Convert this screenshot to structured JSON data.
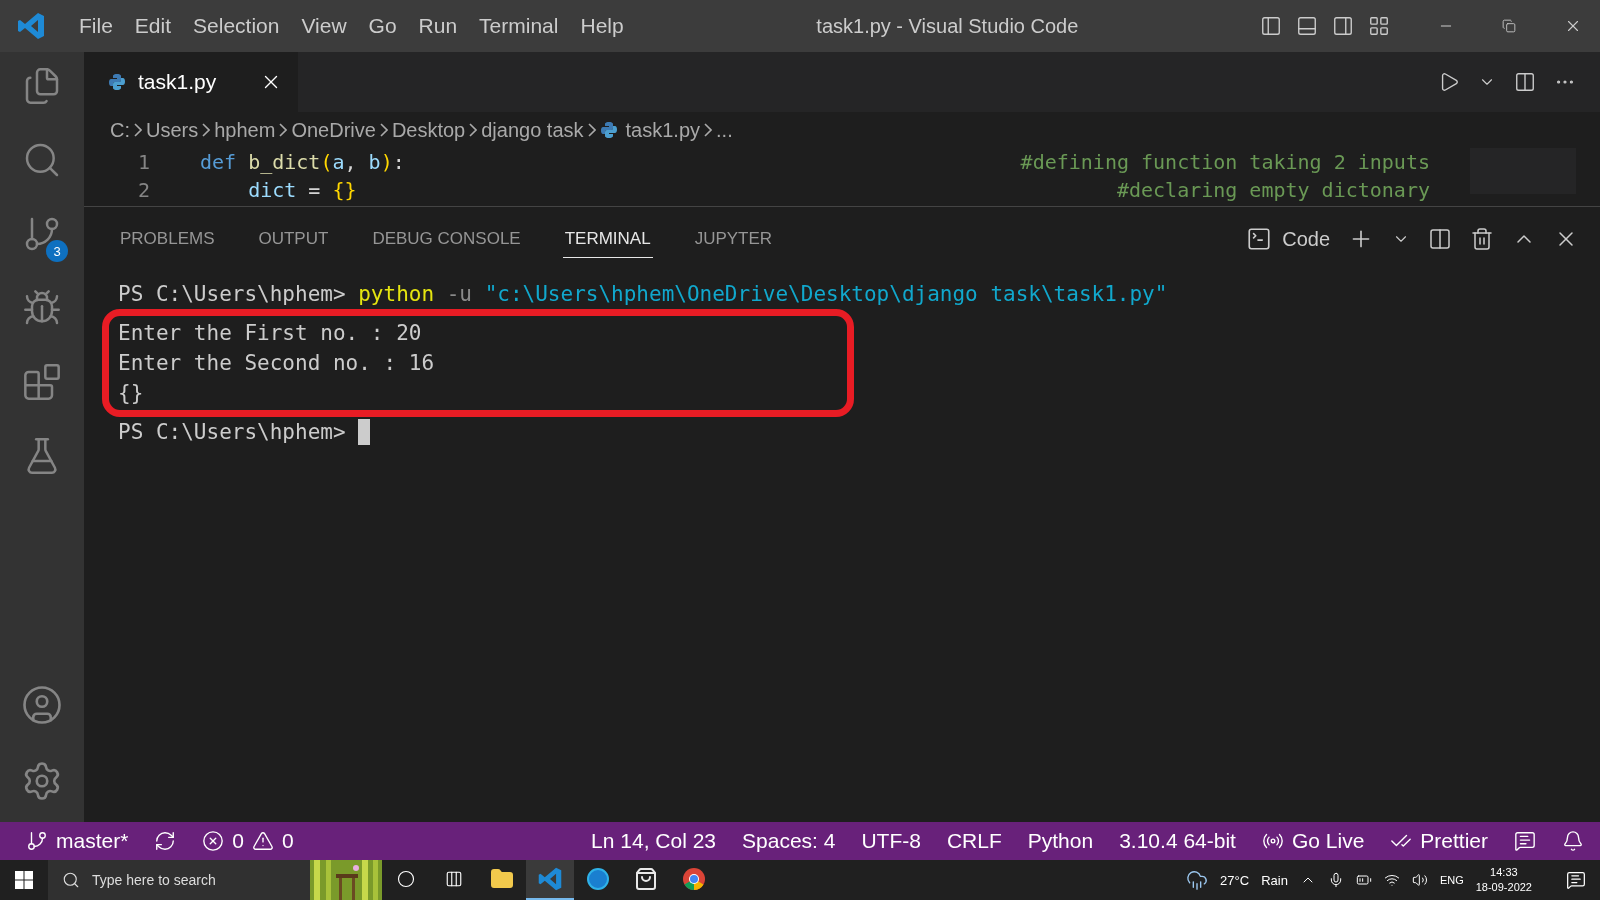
{
  "window": {
    "title": "task1.py - Visual Studio Code"
  },
  "menu": [
    "File",
    "Edit",
    "Selection",
    "View",
    "Go",
    "Run",
    "Terminal",
    "Help"
  ],
  "activity_bar": {
    "source_control_badge": "3"
  },
  "tabs": [
    {
      "label": "task1.py",
      "selected": true
    }
  ],
  "breadcrumbs": [
    {
      "label": "C:",
      "kind": "folder"
    },
    {
      "label": "Users",
      "kind": "folder"
    },
    {
      "label": "hphem",
      "kind": "folder"
    },
    {
      "label": "OneDrive",
      "kind": "folder"
    },
    {
      "label": "Desktop",
      "kind": "folder"
    },
    {
      "label": "django task",
      "kind": "folder"
    },
    {
      "label": "task1.py",
      "kind": "python"
    },
    {
      "label": "...",
      "kind": "folder"
    }
  ],
  "editor": {
    "lines": [
      {
        "number": "1",
        "tokens": [
          {
            "text": "def",
            "kind": "keyword"
          },
          {
            "text": " b_dict",
            "kind": "function"
          },
          {
            "text": "(",
            "kind": "bracket"
          },
          {
            "text": "a",
            "kind": "param"
          },
          {
            "text": ", ",
            "kind": "plain"
          },
          {
            "text": "b",
            "kind": "param"
          },
          {
            "text": ")",
            "kind": "bracket"
          },
          {
            "text": ":",
            "kind": "plain"
          }
        ],
        "comment": "#defining function taking 2 inputs"
      },
      {
        "number": "2",
        "tokens": [
          {
            "text": "    dict",
            "kind": "param"
          },
          {
            "text": " = ",
            "kind": "plain"
          },
          {
            "text": "{}",
            "kind": "bracket"
          }
        ],
        "comment": "#declaring empty dictonary"
      }
    ]
  },
  "panel": {
    "tabs": [
      {
        "label": "PROBLEMS",
        "selected": false
      },
      {
        "label": "OUTPUT",
        "selected": false
      },
      {
        "label": "DEBUG CONSOLE",
        "selected": false
      },
      {
        "label": "TERMINAL",
        "selected": true
      },
      {
        "label": "JUPYTER",
        "selected": false
      }
    ],
    "profile": "Code",
    "terminal": [
      {
        "highlighted": false,
        "cursor": false,
        "segments": [
          {
            "text": "PS C:\\Users\\hphem> ",
            "kind": "plain"
          },
          {
            "text": "python",
            "kind": "command"
          },
          {
            "text": " -u ",
            "kind": "flag"
          },
          {
            "text": "\"c:\\Users\\hphem\\OneDrive\\Desktop\\django task\\task1.py\"",
            "kind": "string"
          }
        ]
      },
      {
        "highlighted": true,
        "cursor": false,
        "segments": [
          {
            "text": "Enter the First no. : 20",
            "kind": "plain"
          }
        ]
      },
      {
        "highlighted": true,
        "cursor": false,
        "segments": [
          {
            "text": "Enter the Second no. : 16",
            "kind": "plain"
          }
        ]
      },
      {
        "highlighted": true,
        "cursor": false,
        "segments": [
          {
            "text": "{}",
            "kind": "plain"
          }
        ]
      },
      {
        "highlighted": false,
        "cursor": true,
        "segments": [
          {
            "text": "PS C:\\Users\\hphem> ",
            "kind": "plain"
          }
        ]
      }
    ]
  },
  "status_bar": {
    "branch": "master*",
    "errors": "0",
    "warnings": "0",
    "right": [
      {
        "text": "Ln 14, Col 23",
        "kind": "text"
      },
      {
        "text": "Spaces: 4",
        "kind": "text"
      },
      {
        "text": "UTF-8",
        "kind": "text"
      },
      {
        "text": "CRLF",
        "kind": "text"
      },
      {
        "text": "Python",
        "kind": "text"
      },
      {
        "text": "3.10.4 64-bit",
        "kind": "text"
      },
      {
        "text": "Go Live",
        "kind": "live"
      },
      {
        "text": "Prettier",
        "kind": "prettier"
      }
    ]
  },
  "taskbar": {
    "search_placeholder": "Type here to search",
    "apps": [
      {
        "kind": "explorer",
        "selected": false
      },
      {
        "kind": "vscode",
        "selected": true
      },
      {
        "kind": "edge",
        "selected": false
      },
      {
        "kind": "store",
        "selected": false
      },
      {
        "kind": "chrome",
        "selected": false
      }
    ],
    "weather": "27°C",
    "weather_text": "Rain",
    "language": "ENG",
    "time": "14:33",
    "date": "18-09-2022"
  }
}
